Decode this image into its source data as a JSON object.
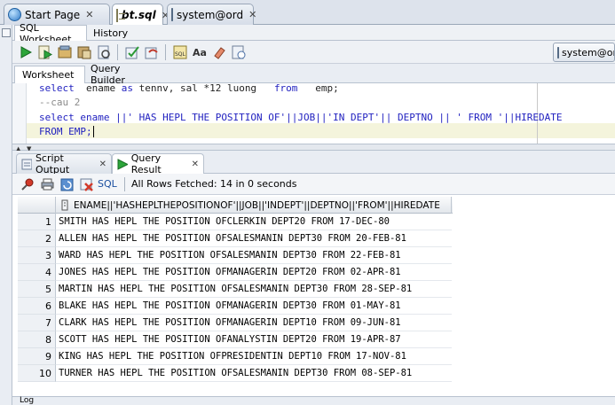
{
  "doc_tabs": [
    {
      "label": "Start Page",
      "icon": "globe-icon"
    },
    {
      "label": "bt.sql",
      "icon": "sql-file-icon"
    },
    {
      "label": "system@ord",
      "icon": "database-icon"
    }
  ],
  "sub_tabs": [
    "SQL Worksheet",
    "History"
  ],
  "connection": "system@ord",
  "worksheet_tabs": [
    "Worksheet",
    "Query Builder"
  ],
  "editor": {
    "line1": {
      "kw1": "select",
      "t1": "  ename ",
      "kw2": "as",
      "t2": " tennv, sal *12 luong   ",
      "kw3": "from",
      "t3": "   emp;"
    },
    "line2": "--cau 2",
    "line3": {
      "kw1": "select",
      "t1": " ename ||' HAS HEPL THE POSITION OF'||",
      "kw2": "JOB",
      "t2": "||'IN DEPT'|| DEPTNO || ' FROM '||HIREDATE"
    },
    "line4": {
      "kw1": "FROM",
      "t1": " EMP;"
    }
  },
  "result_tabs": [
    {
      "label": "Script Output"
    },
    {
      "label": "Query Result"
    }
  ],
  "result_toolbar": {
    "sql_label": "SQL",
    "status": "All Rows Fetched: 14 in 0 seconds"
  },
  "grid": {
    "column": "ENAME||'HASHEPLTHEPOSITIONOF'||JOB||'INDEPT'||DEPTNO||'FROM'||HIREDATE",
    "rows": [
      {
        "n": "1",
        "v": "SMITH HAS HEPL THE POSITION OFCLERKIN DEPT20 FROM 17-DEC-80"
      },
      {
        "n": "2",
        "v": "ALLEN HAS HEPL THE POSITION OFSALESMANIN DEPT30 FROM 20-FEB-81"
      },
      {
        "n": "3",
        "v": "WARD HAS HEPL THE POSITION OFSALESMANIN DEPT30 FROM 22-FEB-81"
      },
      {
        "n": "4",
        "v": "JONES HAS HEPL THE POSITION OFMANAGERIN DEPT20 FROM 02-APR-81"
      },
      {
        "n": "5",
        "v": "MARTIN HAS HEPL THE POSITION OFSALESMANIN DEPT30 FROM 28-SEP-81"
      },
      {
        "n": "6",
        "v": "BLAKE HAS HEPL THE POSITION OFMANAGERIN DEPT30 FROM 01-MAY-81"
      },
      {
        "n": "7",
        "v": "CLARK HAS HEPL THE POSITION OFMANAGERIN DEPT10 FROM 09-JUN-81"
      },
      {
        "n": "8",
        "v": "SCOTT HAS HEPL THE POSITION OFANALYSTIN DEPT20 FROM 19-APR-87"
      },
      {
        "n": "9",
        "v": "KING HAS HEPL THE POSITION OFPRESIDENTIN DEPT10 FROM 17-NOV-81"
      },
      {
        "n": "10",
        "v": "TURNER HAS HEPL THE POSITION OFSALESMANIN DEPT30 FROM 08-SEP-81"
      }
    ]
  },
  "bottom_tab": "Log"
}
